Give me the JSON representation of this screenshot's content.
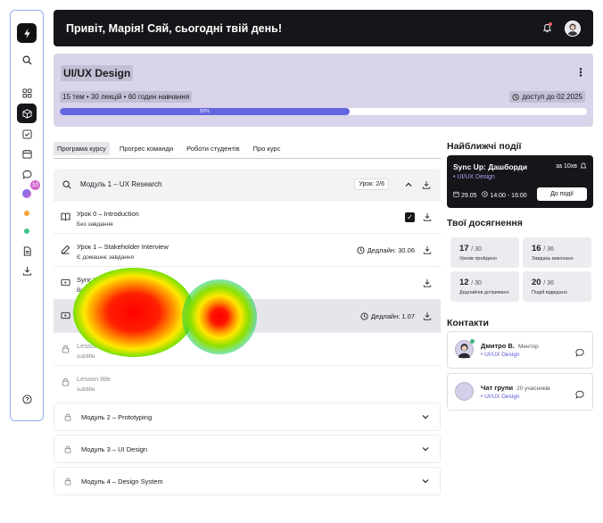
{
  "header": {
    "greeting": "Привіт, Марія! Сяй, сьогодні твій день!"
  },
  "sidebar": {
    "icons": [
      "lightning-icon",
      "search-icon",
      "grid-icon",
      "cube-icon",
      "checkbox-icon",
      "calendar-icon",
      "chat-icon",
      "notifications-icon",
      "orange-dot",
      "green-dot",
      "document-icon",
      "download-icon",
      "help-icon"
    ],
    "badge": "10"
  },
  "course": {
    "title": "UI/UX Design",
    "meta": "15 тем • 30 лекцій • 60 годин навчання",
    "access": "доступ до 02.2025",
    "progress_label": "55%",
    "progress": 0.55
  },
  "tabs": [
    "Програма курсу",
    "Прогрес команди",
    "Роботи студентів",
    "Про курс"
  ],
  "module_open": {
    "title": "Модуль 1 – UX Research",
    "lesson_count": "Урок: 2/6",
    "lessons": [
      {
        "title": "Урок 0 – Introduction",
        "subtitle": "Без завдання",
        "deadline": ""
      },
      {
        "title": "Урок 1 – Stakeholder Interview",
        "subtitle": "Є домашнє завдання",
        "deadline": "Дедлайн: 30.06"
      },
      {
        "title": "Sync Up – 1",
        "subtitle": "Відеозап",
        "deadline": ""
      },
      {
        "title": "Лекц",
        "subtitle": "subtit",
        "deadline": "Дедлайн: 1.07"
      },
      {
        "title": "Lesson title",
        "subtitle": "subtitle",
        "deadline": ""
      },
      {
        "title": "Lesson title",
        "subtitle": "subtitle",
        "deadline": ""
      }
    ]
  },
  "modules_closed": [
    {
      "title": "Модуль 2 – Prototyping"
    },
    {
      "title": "Модуль 3 – UI Design"
    },
    {
      "title": "Модуль 4 – Design System"
    }
  ],
  "events": {
    "heading": "Найближчі події",
    "title": "Sync Up: Дашборди",
    "in": "за 10хв",
    "tag": "UI/UX Design",
    "date": "29.05",
    "time": "14:00 - 16:00",
    "button": "До події"
  },
  "achievements": {
    "heading": "Твої досягнення",
    "items": [
      {
        "value": "17",
        "total": "/ 30",
        "label": "Уроків пройдено"
      },
      {
        "value": "16",
        "total": "/ 36",
        "label": "Завдань виконано"
      },
      {
        "value": "12",
        "total": "/ 30",
        "label": "Дедлайнів дотримано"
      },
      {
        "value": "20",
        "total": "/ 36",
        "label": "Подій відвідано"
      }
    ]
  },
  "contacts": {
    "heading": "Контакти",
    "items": [
      {
        "name": "Дмитро В.",
        "role": "Ментор",
        "tag": "UI/UX Design"
      },
      {
        "name": "Чат групи",
        "role": "20 учасників",
        "tag": "UI/UX Design"
      }
    ]
  },
  "colors": {
    "accent": "#6466e0",
    "dark": "#16161a",
    "banner": "#d9d4e9"
  }
}
